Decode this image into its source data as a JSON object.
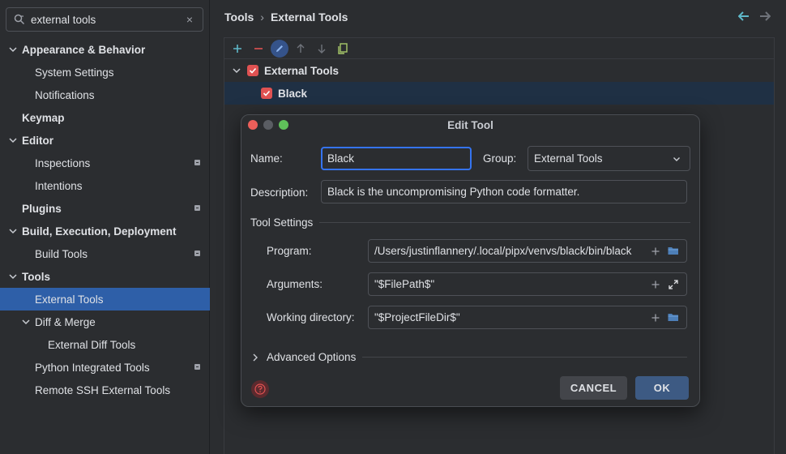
{
  "search": {
    "value": "external tools",
    "clear_icon": "×"
  },
  "sidebar": {
    "items": [
      {
        "label": "Appearance & Behavior",
        "level": 0,
        "bold": true,
        "chevron": "down"
      },
      {
        "label": "System Settings",
        "level": 1
      },
      {
        "label": "Notifications",
        "level": 1
      },
      {
        "label": "Keymap",
        "level": 0,
        "bold": true
      },
      {
        "label": "Editor",
        "level": 0,
        "bold": true,
        "chevron": "down"
      },
      {
        "label": "Inspections",
        "level": 1,
        "badge": true
      },
      {
        "label": "Intentions",
        "level": 1
      },
      {
        "label": "Plugins",
        "level": 0,
        "bold": true,
        "badge": true
      },
      {
        "label": "Build, Execution, Deployment",
        "level": 0,
        "bold": true,
        "chevron": "down"
      },
      {
        "label": "Build Tools",
        "level": 1,
        "badge": true
      },
      {
        "label": "Tools",
        "level": 0,
        "bold": true,
        "chevron": "down"
      },
      {
        "label": "External Tools",
        "level": 1,
        "selected": true
      },
      {
        "label": "Diff & Merge",
        "level": 1,
        "chevron": "down"
      },
      {
        "label": "External Diff Tools",
        "level": 2
      },
      {
        "label": "Python Integrated Tools",
        "level": 1,
        "badge": true
      },
      {
        "label": "Remote SSH External Tools",
        "level": 1
      }
    ]
  },
  "breadcrumb": {
    "parent": "Tools",
    "separator": "›",
    "current": "External Tools"
  },
  "toolbar": {
    "icons": [
      "add-icon",
      "remove-icon",
      "edit-icon",
      "move-up-icon",
      "move-down-icon",
      "copy-icon"
    ]
  },
  "tree": {
    "group_label": "External Tools",
    "tool_label": "Black"
  },
  "dialog": {
    "title": "Edit Tool",
    "name_label": "Name:",
    "name_value": "Black",
    "group_label": "Group:",
    "group_value": "External Tools",
    "description_label": "Description:",
    "description_value": "Black is the uncompromising Python code formatter.",
    "tool_settings_label": "Tool Settings",
    "program_label": "Program:",
    "program_value": "/Users/justinflannery/.local/pipx/venvs/black/bin/black",
    "arguments_label": "Arguments:",
    "arguments_value": "\"$FilePath$\"",
    "working_dir_label": "Working directory:",
    "working_dir_value": "\"$ProjectFileDir$\"",
    "advanced_label": "Advanced Options",
    "cancel_label": "CANCEL",
    "ok_label": "OK"
  },
  "colors": {
    "accent": "#3574f0",
    "selection": "#2e5fa8",
    "checkbox": "#e05252",
    "ok_button": "#3d5a83"
  }
}
